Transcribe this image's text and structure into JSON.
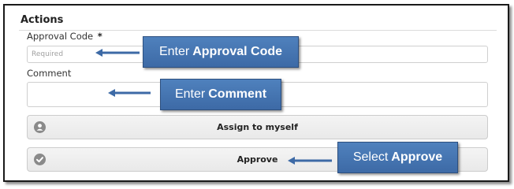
{
  "section": {
    "title": "Actions"
  },
  "approval_code": {
    "label": "Approval Code",
    "required_mark": "*",
    "placeholder": "Required"
  },
  "comment": {
    "label": "Comment"
  },
  "buttons": {
    "assign": {
      "label": "Assign to myself",
      "icon": "user-icon"
    },
    "approve": {
      "label": "Approve",
      "icon": "check-circle-icon"
    }
  },
  "callouts": {
    "approval_code": {
      "prefix": "Enter",
      "bold": "Approval Code"
    },
    "comment": {
      "prefix": "Enter",
      "bold": "Comment"
    },
    "approve": {
      "prefix": "Select",
      "bold": "Approve"
    }
  },
  "colors": {
    "callout_fill": "#4f81bd",
    "arrow": "#3d6aa6",
    "icon_gray": "#8a8a8a"
  }
}
